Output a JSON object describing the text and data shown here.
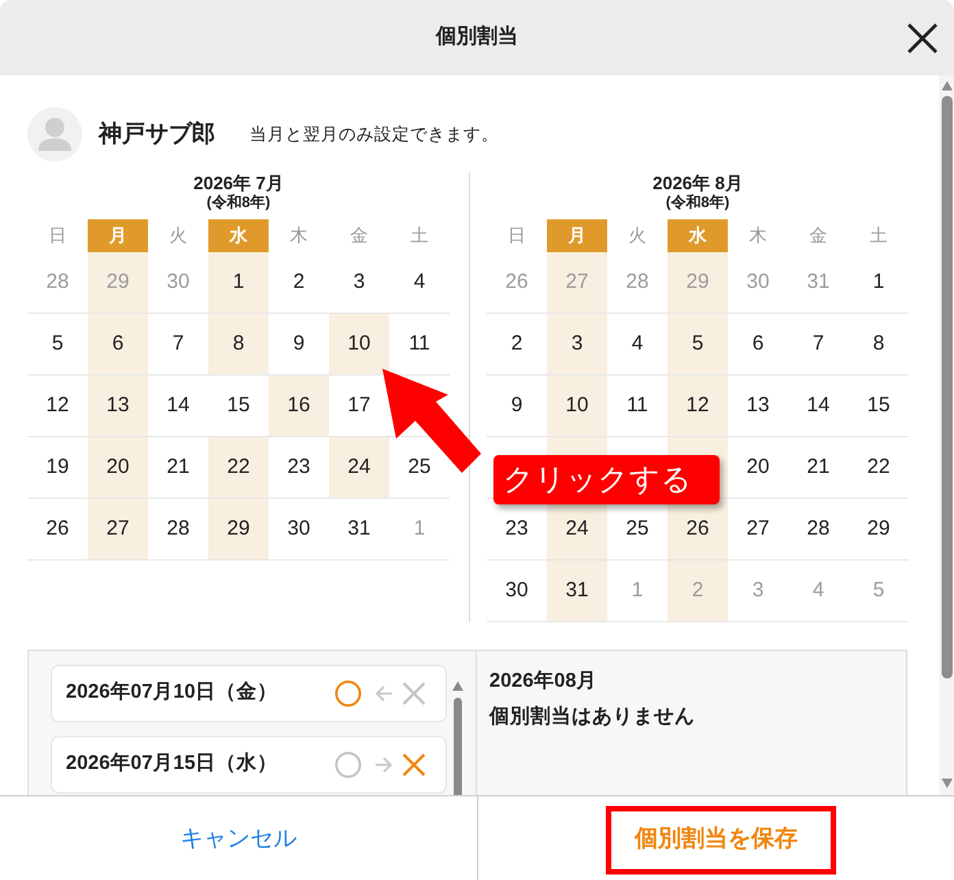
{
  "dialog": {
    "title": "個別割当"
  },
  "user": {
    "name": "神戸サブ郎",
    "note": "当月と翌月のみ設定できます。"
  },
  "calendars": [
    {
      "title": "2026年 7月",
      "era": "(令和8年)",
      "weekdays": [
        {
          "label": "日",
          "selected": false
        },
        {
          "label": "月",
          "selected": true
        },
        {
          "label": "火",
          "selected": false
        },
        {
          "label": "水",
          "selected": true
        },
        {
          "label": "木",
          "selected": false
        },
        {
          "label": "金",
          "selected": false
        },
        {
          "label": "土",
          "selected": false
        }
      ],
      "weeks": [
        [
          {
            "day": "28",
            "muted": true,
            "highlighted": false
          },
          {
            "day": "29",
            "muted": true,
            "highlighted": true
          },
          {
            "day": "30",
            "muted": true,
            "highlighted": false
          },
          {
            "day": "1",
            "muted": false,
            "highlighted": true
          },
          {
            "day": "2",
            "muted": false,
            "highlighted": false
          },
          {
            "day": "3",
            "muted": false,
            "highlighted": false
          },
          {
            "day": "4",
            "muted": false,
            "highlighted": false
          }
        ],
        [
          {
            "day": "5",
            "muted": false,
            "highlighted": false
          },
          {
            "day": "6",
            "muted": false,
            "highlighted": true
          },
          {
            "day": "7",
            "muted": false,
            "highlighted": false
          },
          {
            "day": "8",
            "muted": false,
            "highlighted": true
          },
          {
            "day": "9",
            "muted": false,
            "highlighted": false
          },
          {
            "day": "10",
            "muted": false,
            "highlighted": true
          },
          {
            "day": "11",
            "muted": false,
            "highlighted": false
          }
        ],
        [
          {
            "day": "12",
            "muted": false,
            "highlighted": false
          },
          {
            "day": "13",
            "muted": false,
            "highlighted": true
          },
          {
            "day": "14",
            "muted": false,
            "highlighted": false
          },
          {
            "day": "15",
            "muted": false,
            "highlighted": false
          },
          {
            "day": "16",
            "muted": false,
            "highlighted": true
          },
          {
            "day": "17",
            "muted": false,
            "highlighted": false
          },
          {
            "highlighted": false
          }
        ],
        [
          {
            "day": "19",
            "muted": false,
            "highlighted": false
          },
          {
            "day": "20",
            "muted": false,
            "highlighted": true
          },
          {
            "day": "21",
            "muted": false,
            "highlighted": false
          },
          {
            "day": "22",
            "muted": false,
            "highlighted": true
          },
          {
            "day": "23",
            "muted": false,
            "highlighted": false
          },
          {
            "day": "24",
            "muted": false,
            "highlighted": true
          },
          {
            "day": "25",
            "muted": false,
            "highlighted": false
          }
        ],
        [
          {
            "day": "26",
            "muted": false,
            "highlighted": false
          },
          {
            "day": "27",
            "muted": false,
            "highlighted": true
          },
          {
            "day": "28",
            "muted": false,
            "highlighted": false
          },
          {
            "day": "29",
            "muted": false,
            "highlighted": true
          },
          {
            "day": "30",
            "muted": false,
            "highlighted": false
          },
          {
            "day": "31",
            "muted": false,
            "highlighted": false
          },
          {
            "day": "1",
            "muted": true,
            "highlighted": false
          }
        ]
      ]
    },
    {
      "title": "2026年 8月",
      "era": "(令和8年)",
      "weekdays": [
        {
          "label": "日",
          "selected": false
        },
        {
          "label": "月",
          "selected": true
        },
        {
          "label": "火",
          "selected": false
        },
        {
          "label": "水",
          "selected": true
        },
        {
          "label": "木",
          "selected": false
        },
        {
          "label": "金",
          "selected": false
        },
        {
          "label": "土",
          "selected": false
        }
      ],
      "weeks": [
        [
          {
            "day": "26",
            "muted": true,
            "highlighted": false
          },
          {
            "day": "27",
            "muted": true,
            "highlighted": true
          },
          {
            "day": "28",
            "muted": true,
            "highlighted": false
          },
          {
            "day": "29",
            "muted": true,
            "highlighted": true
          },
          {
            "day": "30",
            "muted": true,
            "highlighted": false
          },
          {
            "day": "31",
            "muted": true,
            "highlighted": false
          },
          {
            "day": "1",
            "muted": false,
            "highlighted": false
          }
        ],
        [
          {
            "day": "2",
            "muted": false,
            "highlighted": false
          },
          {
            "day": "3",
            "muted": false,
            "highlighted": true
          },
          {
            "day": "4",
            "muted": false,
            "highlighted": false
          },
          {
            "day": "5",
            "muted": false,
            "highlighted": true
          },
          {
            "day": "6",
            "muted": false,
            "highlighted": false
          },
          {
            "day": "7",
            "muted": false,
            "highlighted": false
          },
          {
            "day": "8",
            "muted": false,
            "highlighted": false
          }
        ],
        [
          {
            "day": "9",
            "muted": false,
            "highlighted": false
          },
          {
            "day": "10",
            "muted": false,
            "highlighted": true
          },
          {
            "day": "11",
            "muted": false,
            "highlighted": false
          },
          {
            "day": "12",
            "muted": false,
            "highlighted": true
          },
          {
            "day": "13",
            "muted": false,
            "highlighted": false
          },
          {
            "day": "14",
            "muted": false,
            "highlighted": false
          },
          {
            "day": "15",
            "muted": false,
            "highlighted": false
          }
        ],
        [
          {
            "highlighted": false
          },
          {
            "highlighted": true
          },
          {
            "highlighted": false
          },
          {
            "highlighted": true
          },
          {
            "day": "20",
            "muted": false,
            "highlighted": false
          },
          {
            "day": "21",
            "muted": false,
            "highlighted": false
          },
          {
            "day": "22",
            "muted": false,
            "highlighted": false
          }
        ],
        [
          {
            "day": "23",
            "muted": false,
            "highlighted": false
          },
          {
            "day": "24",
            "muted": false,
            "highlighted": true
          },
          {
            "day": "25",
            "muted": false,
            "highlighted": false
          },
          {
            "day": "26",
            "muted": false,
            "highlighted": true
          },
          {
            "day": "27",
            "muted": false,
            "highlighted": false
          },
          {
            "day": "28",
            "muted": false,
            "highlighted": false
          },
          {
            "day": "29",
            "muted": false,
            "highlighted": false
          }
        ],
        [
          {
            "day": "30",
            "muted": false,
            "highlighted": false
          },
          {
            "day": "31",
            "muted": false,
            "highlighted": true
          },
          {
            "day": "1",
            "muted": true,
            "highlighted": false
          },
          {
            "day": "2",
            "muted": true,
            "highlighted": true
          },
          {
            "day": "3",
            "muted": true,
            "highlighted": false
          },
          {
            "day": "4",
            "muted": true,
            "highlighted": false
          },
          {
            "day": "5",
            "muted": true,
            "highlighted": false
          }
        ]
      ]
    }
  ],
  "assignments": {
    "items": [
      {
        "date": "2026年07月10日（金）",
        "circle_on": true,
        "cross_on": false
      },
      {
        "date": "2026年07月15日（水）",
        "circle_on": false,
        "cross_on": true
      }
    ],
    "summary": {
      "month": "2026年08月",
      "message": "個別割当はありません"
    }
  },
  "callout": {
    "text": "クリックする"
  },
  "buttons": [
    {
      "label": "キャンセル",
      "kind": "cancel"
    },
    {
      "label": "個別割当を保存",
      "kind": "save"
    }
  ]
}
